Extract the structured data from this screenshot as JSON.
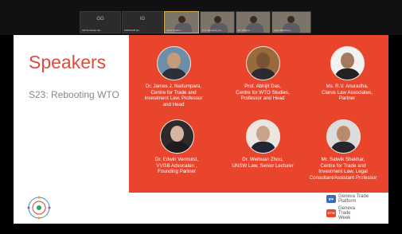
{
  "tiles": [
    {
      "initials": "GG",
      "name": "Gill Nurstamp Sa..."
    },
    {
      "initials": "IG",
      "name": "IAMOHAR Qu..."
    },
    {
      "initials": "",
      "name": "Jame Nedum..."
    },
    {
      "initials": "",
      "name": "K.K. Desouza pro..."
    },
    {
      "initials": "",
      "name": "Dr. Waiyee..."
    },
    {
      "initials": "",
      "name": "Anita Bathinam..."
    }
  ],
  "slide": {
    "title": "Speakers",
    "subtitle": "S23: Rebooting WTO"
  },
  "speakers": [
    {
      "name": "Dr. James J. Nedumpara,",
      "line2": "Centre for Trade and",
      "line3": "Investment Law, Professor",
      "line4": "and Head"
    },
    {
      "name": "Prof. Abhijit Das,",
      "line2": "Centre for WTO Studies,",
      "line3": "Professor and Head",
      "line4": ""
    },
    {
      "name": "Ms. R.V. Anuradha,",
      "line2": "Clarus Law Associates,",
      "line3": "Partner",
      "line4": ""
    },
    {
      "name": "Dr. Edwin Vermulst,",
      "line2": "VVGB Advocaten ,",
      "line3": "Founding Partner",
      "line4": ""
    },
    {
      "name": "Dr. Weihuan Zhou,",
      "line2": "UNSW Law, Senior Lecturer",
      "line3": "",
      "line4": ""
    },
    {
      "name": "Mr. Satwik Shekhar,",
      "line2": "Centre for Trade and",
      "line3": "Investment Law, Legal",
      "line4": "Consultant/Assistant Professor"
    }
  ],
  "logos": {
    "gtp_badge": "gtp",
    "gtp_text1": "Geneva Trade",
    "gtp_text2": "Platform",
    "gtw_badge": "GTW",
    "gtw_text1": "Geneva",
    "gtw_text2": "Trade",
    "gtw_text3": "Week"
  },
  "colors": {
    "accent": "#e8452c",
    "title": "#e14a3a"
  }
}
